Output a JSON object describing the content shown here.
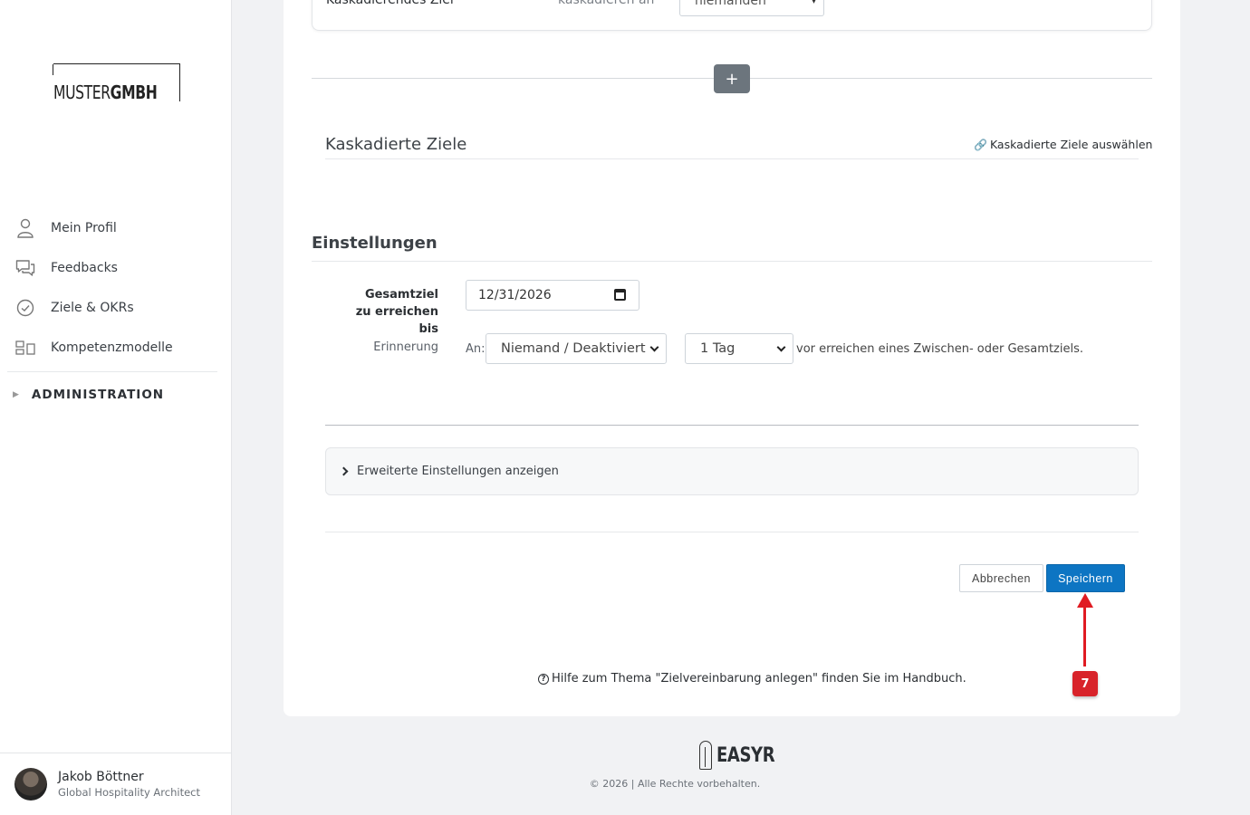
{
  "sidebar": {
    "logo": {
      "part1": "MUSTER",
      "part2": "GMBH"
    },
    "items": [
      {
        "label": "Mein Profil",
        "icon": "person-icon"
      },
      {
        "label": "Feedbacks",
        "icon": "chat-bubbles-icon"
      },
      {
        "label": "Ziele & OKRs",
        "icon": "check-circle-icon"
      },
      {
        "label": "Kompetenzmodelle",
        "icon": "grid-icon"
      }
    ],
    "admin": {
      "label": "ADMINISTRATION",
      "caret": "▶"
    },
    "user": {
      "name": "Jakob Böttner",
      "role": "Global Hospitality Architect"
    }
  },
  "top": {
    "label": "Kaskadierendes Ziel",
    "label2": "kaskadieren an",
    "select_value": "niemanden"
  },
  "add_button": {
    "symbol": "+"
  },
  "cascaded": {
    "title": "Kaskadierte Ziele",
    "link_icon": "🔗",
    "link_label": "Kaskadierte Ziele auswählen"
  },
  "settings": {
    "title": "Einstellungen",
    "deadline_label": "Gesamtziel zu erreichen bis",
    "deadline_value": "12/31/2026",
    "reminder_label": "Erinnerung",
    "reminder_to_label": "An:",
    "reminder_to_value": "Niemand / Deaktiviert",
    "reminder_days_value": "1 Tag",
    "reminder_text": "vor erreichen eines Zwischen- oder Gesamtziels."
  },
  "advanced": {
    "label": "Erweiterte Einstellungen anzeigen"
  },
  "actions": {
    "cancel_label": "Abbrechen",
    "save_label": "Speichern"
  },
  "annotation": {
    "step": "7",
    "color": "#e01b22"
  },
  "help": {
    "icon": "?",
    "text": "Hilfe zum Thema \"Zielvereinbarung anlegen\" finden Sie im Handbuch."
  },
  "footer": {
    "brand": "EASYR",
    "copyright": "© 2026 | Alle Rechte vorbehalten."
  },
  "colors": {
    "primary": "#0d75c3",
    "secondary": "#6c757d",
    "background": "#f1f2f4"
  }
}
